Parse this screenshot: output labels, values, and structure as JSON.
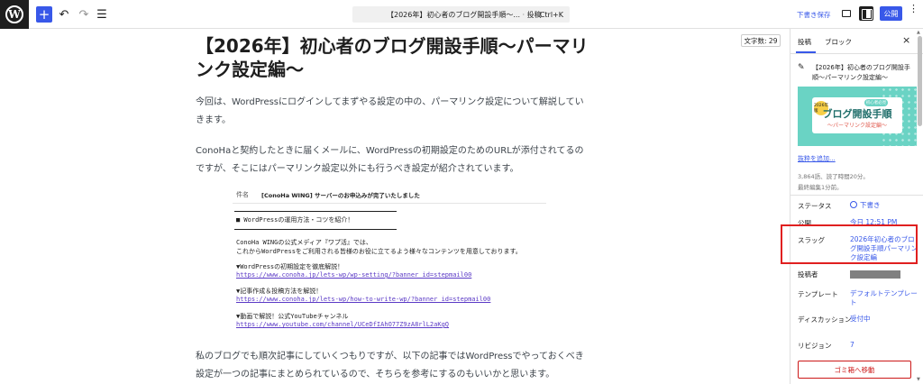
{
  "toolbar": {
    "add_icon": "+",
    "undo_icon": "↶",
    "redo_icon": "↷",
    "listview_icon": "☰",
    "command_doc": "【2026年】初心者のブログ開設手順〜...",
    "command_sep": "·",
    "command_type": "投稿",
    "shortcut": "Ctrl+K",
    "save_draft": "下書き保存",
    "publish": "公開",
    "kebab": "⋮"
  },
  "editor": {
    "word_count": "文字数: 29",
    "title": "【2026年】初心者のブログ開設手順〜パーマリンク設定編〜",
    "paragraphs": [
      "今回は、WordPressにログインしてまずやる設定の中の、パーマリンク設定について解説していきます。",
      "ConoHaと契約したときに届くメールに、WordPressの初期設定のためのURLが添付されてるのですが、そこにはパーマリンク設定以外にも行うべき設定が紹介されています。",
      "私のブログでも順次記事にしていくつもりですが、以下の記事ではWordPressでやっておくべき設定が一つの記事にまとめられているので、そちらを参考にするのもいいかと思います。"
    ],
    "mail": {
      "subject_key": "件名",
      "subject_value": "[ConoHa WING] サーバーのお申込みが完了いたしました",
      "heading": "■ WordPressの運用方法・コツを紹介！",
      "intro1": "ConoHa WINGの公式メディア『ワプ活』では、",
      "intro2": "これからWordPressをご利用される皆様のお役に立てるよう様々なコンテンツを用意しております。",
      "item1_title": "▼WordPressの初期設定を徹底解説！",
      "item1_link": "https://www.conoha.jp/lets-wp/wp-setting/?banner_id=stepmail00",
      "item2_title": "▼記事作成＆投稿方法を解説！",
      "item2_link": "https://www.conoha.jp/lets-wp/how-to-write-wp/?banner_id=stepmail00",
      "item3_title": "▼動画で解説！公式YouTubeチャンネル",
      "item3_link": "https://www.youtube.com/channel/UCeDfIAhO77Z9zA8rlL2aKgQ"
    }
  },
  "sidebar": {
    "tab_post": "投稿",
    "tab_block": "ブロック",
    "close": "×",
    "post_icon": "✎",
    "post_title": "【2026年】初心者のブログ開設手順〜パーマリンク設定編〜",
    "featured": {
      "badge": "2026年版",
      "pill": "初心者必見",
      "title": "ブログ開設手順",
      "subtitle": "〜パーマリンク設定編〜"
    },
    "add_excerpt": "抜粋を追加...",
    "meta1": "3,864語、読了時間20分。",
    "meta2": "最終編集1分前。",
    "status_label": "ステータス",
    "status_value": "下書き",
    "publish_label": "公開",
    "publish_value": "今日 12:51 PM",
    "slug_label": "スラッグ",
    "slug_value": "2026年初心者のブログ開設手順パーマリンク設定編",
    "author_label": "投稿者",
    "template_label": "テンプレート",
    "template_value": "デフォルトテンプレート",
    "discussion_label": "ディスカッション",
    "discussion_value": "受付中",
    "revision_label": "リビジョン",
    "revision_value": "7",
    "trash": "ゴミ箱へ移動"
  },
  "colors": {
    "accent": "#3858e9",
    "danger": "#cc1818",
    "highlight": "#e02020",
    "featured_bg": "#6ad3c4"
  }
}
